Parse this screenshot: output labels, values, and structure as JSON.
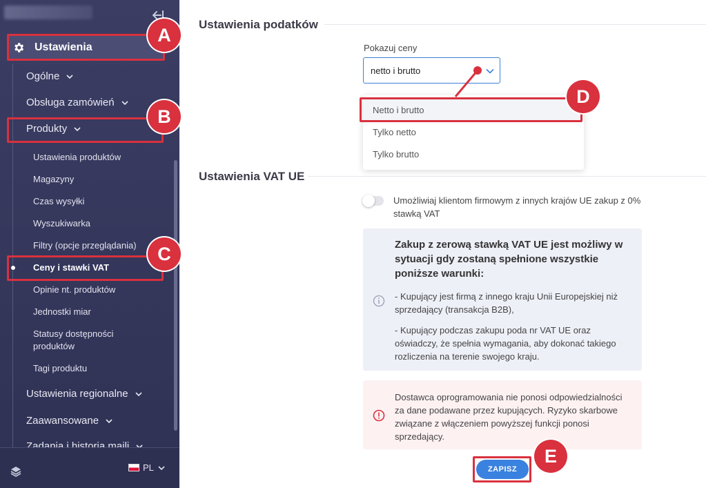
{
  "sidebar": {
    "main_item": "Ustawienia",
    "items": {
      "general": "Ogólne",
      "orders": "Obsługa zamówień",
      "products": "Produkty",
      "regional": "Ustawienia regionalne",
      "advanced": "Zaawansowane",
      "tasks": "Zadania i historia maili"
    },
    "product_subitems": [
      "Ustawienia produktów",
      "Magazyny",
      "Czas wysyłki",
      "Wyszukiwarka",
      "Filtry (opcje przeglądania)",
      "Ceny i stawki VAT",
      "Opinie nt. produktów",
      "Jednostki miar",
      "Statusy dostępności produktów",
      "Tagi produktu"
    ],
    "active_subitem": "Ceny i stawki VAT",
    "language": "PL"
  },
  "tax_section": {
    "title": "Ustawienia podatków",
    "show_prices_label": "Pokazuj ceny",
    "selected_value": "netto i brutto",
    "options": [
      "Netto i brutto",
      "Tylko netto",
      "Tylko brutto"
    ]
  },
  "vat_section": {
    "title": "Ustawienia VAT UE",
    "toggle_label": "Umożliwiaj klientom firmowym z innych krajów UE zakup z 0% stawką VAT",
    "toggle_on": false,
    "info_heading": "Zakup z zerową stawką VAT UE jest możliwy w sytuacji gdy zostaną spełnione wszystkie poniższe warunki:",
    "info_point_1": "- Kupujący jest firmą z innego kraju Unii Europejskiej niż sprzedający (transakcja B2B),",
    "info_point_2": "- Kupujący podczas zakupu poda nr VAT UE oraz oświadczy, że spełnia wymagania, aby dokonać takiego rozliczenia na terenie swojego kraju.",
    "warning_text": "Dostawca oprogramowania nie ponosi odpowiedzialności za dane podawane przez kupujących. Ryzyko skarbowe związane z włączeniem powyższej funkcji ponosi sprzedający."
  },
  "save_label": "ZAPISZ",
  "annotations": [
    "A",
    "B",
    "C",
    "D",
    "E"
  ],
  "colors": {
    "sidebar_bg": "#3b3d63",
    "accent_blue": "#3a82e0",
    "annotation_red": "#d9313e",
    "info_bg": "#eef0f8",
    "warning_bg": "#fdf1f2"
  }
}
